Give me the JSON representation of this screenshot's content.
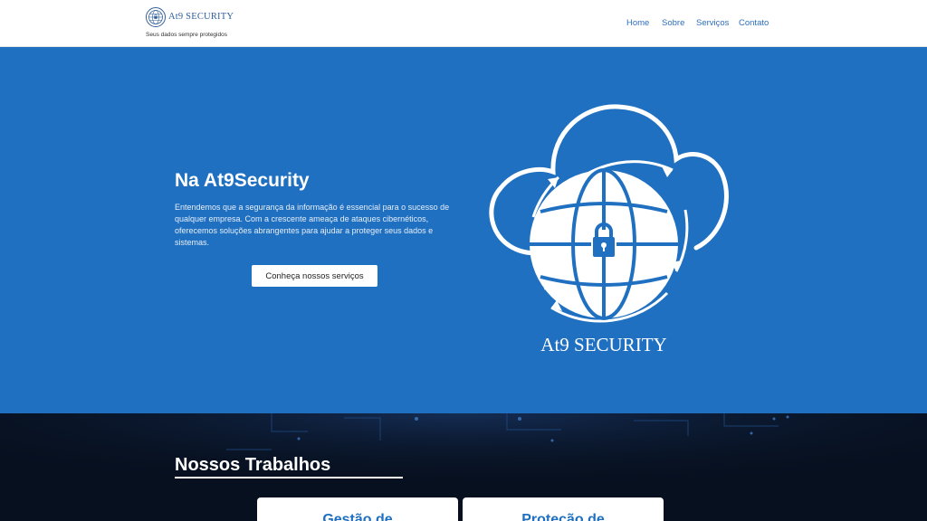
{
  "header": {
    "brand_name": "At9 SECURITY",
    "brand_tagline": "Seus dados sempre protegidos",
    "logo_icon": "globe-lock-icon",
    "nav": [
      {
        "label": "Home"
      },
      {
        "label": "Sobre"
      },
      {
        "label": "Serviços"
      },
      {
        "label": "Contato"
      }
    ]
  },
  "hero": {
    "title": "Na At9Security",
    "text": "Entendemos que a segurança da informação é essencial para o sucesso de qualquer empresa. Com a crescente ameaça de ataques cibernéticos, oferecemos soluções abrangentes para ajudar a proteger seus dados e sistemas.",
    "button_label": "Conheça nossos serviços",
    "logo_caption": "At9 SECURITY",
    "logo_icon": "cloud-globe-lock-icon"
  },
  "works": {
    "title": "Nossos Trabalhos",
    "cards": [
      {
        "title": "Gestão de"
      },
      {
        "title": "Proteção de"
      }
    ]
  },
  "colors": {
    "hero_bg": "#1f70c1",
    "nav_link": "#2d6fbd",
    "works_bg": "#07101f",
    "brand": "#2f5f9a"
  }
}
